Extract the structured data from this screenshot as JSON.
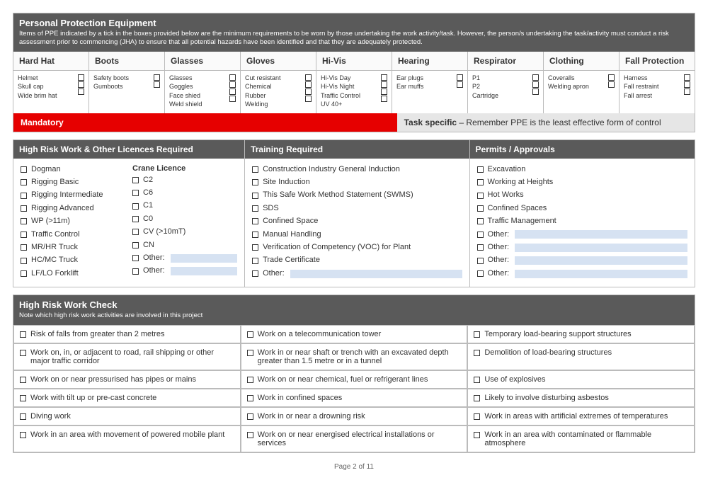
{
  "ppe_header": {
    "title": "Personal Protection Equipment",
    "sub": "Items of PPE indicated by a tick in the boxes provided below are the minimum requirements to be worn by those undertaking the work activity/task. However, the person/s undertaking the task/activity must conduct a risk assessment prior to commencing (JHA) to ensure that all potential hazards have been identified and that they are adequately protected."
  },
  "ppe_cols": [
    {
      "h": "Hard Hat",
      "items": [
        "Helmet",
        "Skull cap",
        "Wide brim hat"
      ]
    },
    {
      "h": "Boots",
      "items": [
        "Safety boots",
        "Gumboots"
      ]
    },
    {
      "h": "Glasses",
      "items": [
        "Glasses",
        "Goggles",
        "Face shied",
        "Weld shield"
      ]
    },
    {
      "h": "Gloves",
      "items": [
        "Cut resistant",
        "Chemical",
        "Rubber",
        "Welding"
      ]
    },
    {
      "h": "Hi-Vis",
      "items": [
        "Hi-Vis Day",
        "Hi-Vis Night",
        "Traffic Control",
        "UV 40+"
      ]
    },
    {
      "h": "Hearing",
      "items": [
        "Ear plugs",
        "Ear muffs"
      ]
    },
    {
      "h": "Respirator",
      "items": [
        "P1",
        "P2",
        "Cartridge"
      ]
    },
    {
      "h": "Clothing",
      "items": [
        "Coveralls",
        "Welding apron"
      ]
    },
    {
      "h": "Fall Protection",
      "items": [
        "Harness",
        "Fall restraint",
        "Fall arrest"
      ]
    }
  ],
  "mandatory": "Mandatory",
  "task_specific_label": "Task specific",
  "task_specific_note": " – Remember PPE is the least effective form of control",
  "licences_hdr": "High Risk Work & Other Licences Required",
  "licences_a": [
    "Dogman",
    "Rigging Basic",
    "Rigging Intermediate",
    "Rigging Advanced",
    "WP (>11m)",
    "Traffic Control",
    "MR/HR Truck",
    "HC/MC Truck",
    "LF/LO Forklift"
  ],
  "crane_hdr": "Crane Licence",
  "crane_items": [
    "C2",
    "C6",
    "C1",
    "C0",
    "CV (>10mT)",
    "CN"
  ],
  "other_label": "Other:",
  "training_hdr": "Training Required",
  "training_items": [
    "Construction Industry General Induction",
    "Site Induction",
    "This Safe Work Method Statement (SWMS)",
    "SDS",
    "Confined Space",
    "Manual Handling",
    "Verification of Competency (VOC) for Plant",
    "Trade Certificate"
  ],
  "permits_hdr": "Permits / Approvals",
  "permits_items": [
    "Excavation",
    "Working at Heights",
    "Hot Works",
    "Confined Spaces",
    "Traffic Management"
  ],
  "hrw_hdr": "High Risk Work Check",
  "hrw_sub": "Note which high risk work activities are involved in this project",
  "hrw_rows": [
    [
      "Risk of falls from greater than 2 metres",
      "Work on a telecommunication tower",
      "Temporary load-bearing support structures"
    ],
    [
      "Work on, in, or adjacent to road, rail shipping or other major traffic corridor",
      "Work in or near shaft or trench with an excavated depth greater than 1.5 metre or in a tunnel",
      "Demolition of load-bearing structures"
    ],
    [
      "Work on or near pressurised has pipes or mains",
      "Work on or near chemical, fuel or refrigerant lines",
      "Use of explosives"
    ],
    [
      "Work with tilt up or pre-cast concrete",
      "Work in confined spaces",
      "Likely to involve disturbing asbestos"
    ],
    [
      "Diving work",
      "Work in or near a drowning risk",
      "Work in areas with artificial extremes of temperatures"
    ],
    [
      "Work in an area with movement of powered mobile plant",
      "Work on or near energised electrical installations or services",
      "Work in an area with contaminated or flammable atmosphere"
    ]
  ],
  "page_footer": "Page 2 of 11"
}
